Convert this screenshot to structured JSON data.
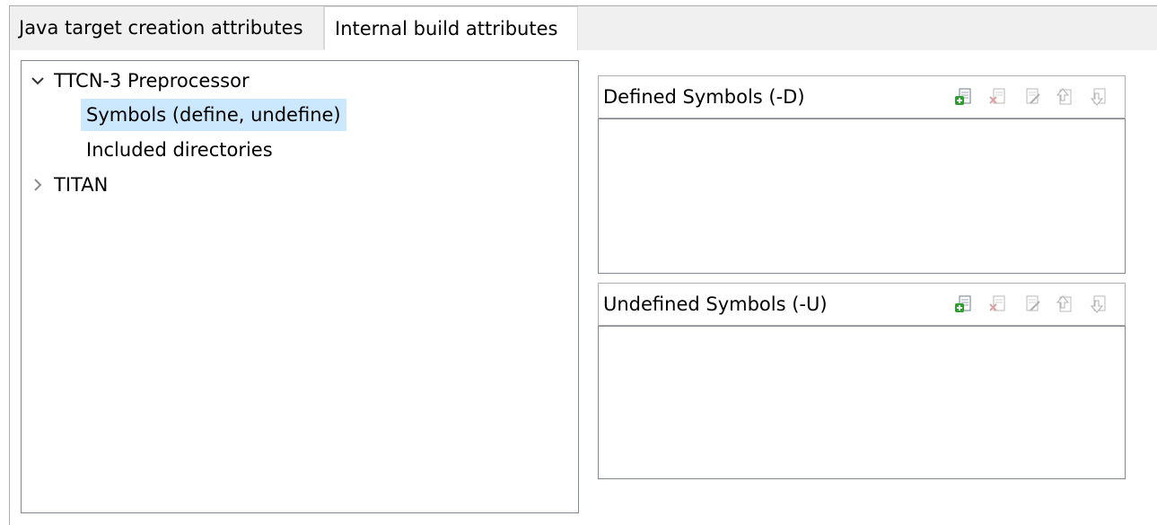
{
  "tabs": [
    {
      "label": "Java target creation attributes",
      "active": false
    },
    {
      "label": "Internal build attributes",
      "active": true
    }
  ],
  "tree": {
    "items": [
      {
        "label": "TTCN-3 Preprocessor",
        "expanded": true
      },
      {
        "label": "Symbols (define, undefine)",
        "selected": true
      },
      {
        "label": "Included directories"
      },
      {
        "label": "TITAN",
        "expanded": false
      }
    ]
  },
  "defined_group": {
    "title": "Defined Symbols (-D)",
    "toolbar": [
      "add-icon",
      "delete-icon",
      "edit-icon",
      "move-up-icon",
      "move-down-icon"
    ]
  },
  "undefined_group": {
    "title": "Undefined Symbols (-U)",
    "toolbar": [
      "add-icon",
      "delete-icon",
      "edit-icon",
      "move-up-icon",
      "move-down-icon"
    ]
  },
  "colors": {
    "selection": "#cce8ff",
    "tab_strip": "#f0f0f0",
    "border": "#828790",
    "add_green": "#2e9e2e"
  }
}
